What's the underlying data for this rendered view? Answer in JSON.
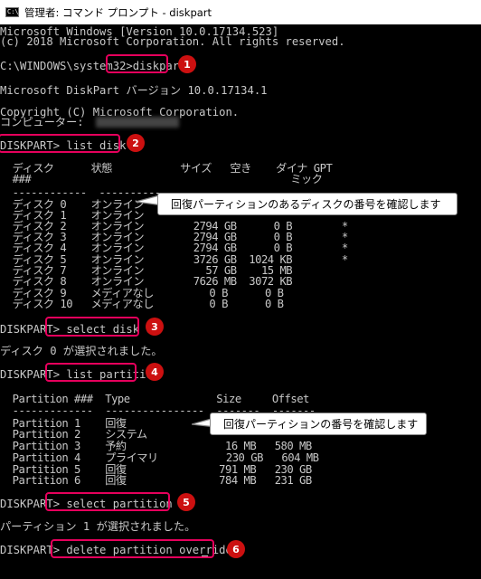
{
  "window": {
    "title": "管理者: コマンド プロンプト - diskpart",
    "icon_label": "C:\\_"
  },
  "lines": {
    "ver1": "Microsoft Windows [Version 10.0.17134.523]",
    "ver2": "(c) 2018 Microsoft Corporation. All rights reserved.",
    "prompt1": "C:\\WINDOWS\\system32>diskpart",
    "dpver": "Microsoft DiskPart バージョン 10.0.17134.1",
    "copyright": "Copyright (C) Microsoft Corporation.",
    "computer": "コンピューター:",
    "cmd_list_disk": "DISKPART> list disk",
    "disk_header1": "  ディスク      状態           サイズ   空き    ダイナ GPT",
    "disk_header2": "  ###                                          ミック",
    "disk_sep": "  ------------  -------------  -------  -------  ---  ---",
    "disk_rows": [
      "  ディスク 0    オンライン",
      "  ディスク 1    オンライン",
      "  ディスク 2    オンライン        2794 GB      0 B        *",
      "  ディスク 3    オンライン        2794 GB      0 B        *",
      "  ディスク 4    オンライン        2794 GB      0 B        *",
      "  ディスク 5    オンライン        3726 GB  1024 KB        *",
      "  ディスク 7    オンライン          57 GB    15 MB",
      "  ディスク 8    オンライン        7626 MB  3072 KB",
      "  ディスク 9    メディアなし         0 B      0 B",
      "  ディスク 10   メディアなし         0 B      0 B"
    ],
    "cmd_select_disk": "DISKPART> select disk 0",
    "selected_disk": "ディスク 0 が選択されました。",
    "cmd_list_partition": "DISKPART> list partition",
    "part_header": "  Partition ###  Type              Size     Offset",
    "part_sep": "  -------------  ----------------  -------  -------",
    "part_rows": [
      "  Partition 1    回復",
      "  Partition 2    システム",
      "  Partition 3    予約                16 MB   580 MB",
      "  Partition 4    プライマリ           230 GB   604 MB",
      "  Partition 5    回復               791 MB   230 GB",
      "  Partition 6    回復               784 MB   231 GB"
    ],
    "cmd_select_partition": "DISKPART> select partition 1",
    "selected_partition": "パーティション 1 が選択されました。",
    "cmd_delete": "DISKPART> delete partition override"
  },
  "annotations": {
    "badges": [
      "1",
      "2",
      "3",
      "4",
      "5",
      "6"
    ],
    "callout_disk": "回復パーティションのあるディスクの番号を確認します",
    "callout_partition": "回復パーティションの番号を確認します"
  },
  "colors": {
    "console_bg": "#000000",
    "console_text": "#c8c8c8",
    "highlight": "#e6005c",
    "badge": "#cc1010"
  }
}
